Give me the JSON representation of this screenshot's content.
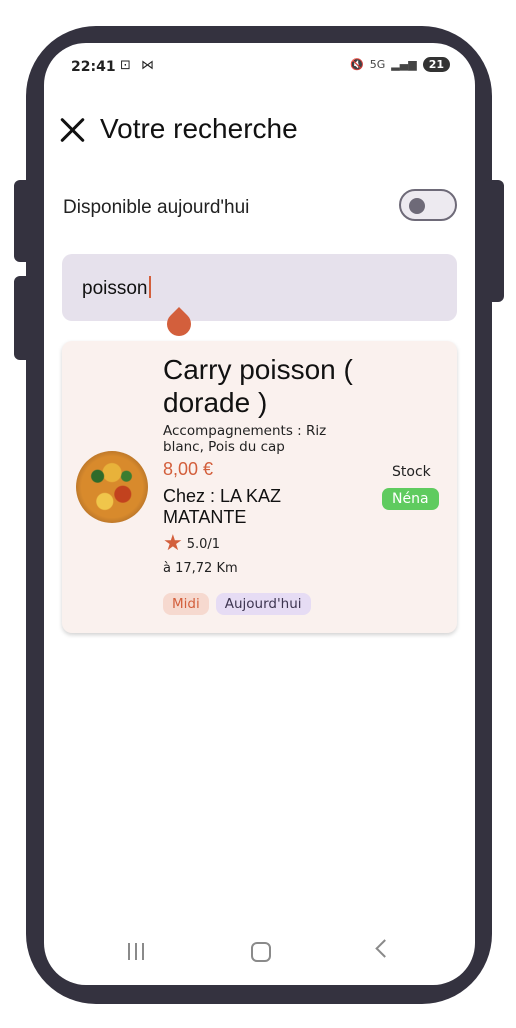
{
  "status_bar": {
    "time": "22:41",
    "left_icons": "⊡ ⋈",
    "network": "5G",
    "battery": "21"
  },
  "header": {
    "title": "Votre recherche"
  },
  "filters": {
    "available_today_label": "Disponible aujourd'hui",
    "available_today_on": false
  },
  "search": {
    "value": "poisson"
  },
  "results": [
    {
      "title": "Carry poisson ( dorade )",
      "sides": "Accompagnements : Riz blanc, Pois du cap",
      "price": "8,00 €",
      "chef": "Chez : LA KAZ MATANTE",
      "rating": "5.0/1",
      "distance": "à 17,72 Km",
      "stock_label": "Stock",
      "stock_badge": "Néna",
      "tag_meal": "Midi",
      "tag_day": "Aujourd'hui"
    }
  ],
  "colors": {
    "accent": "#d35f3c",
    "frame": "#34323f",
    "search_bg": "#e6e1ec",
    "card_bg": "#faf1ee",
    "stock_green": "#5fcb5f"
  }
}
